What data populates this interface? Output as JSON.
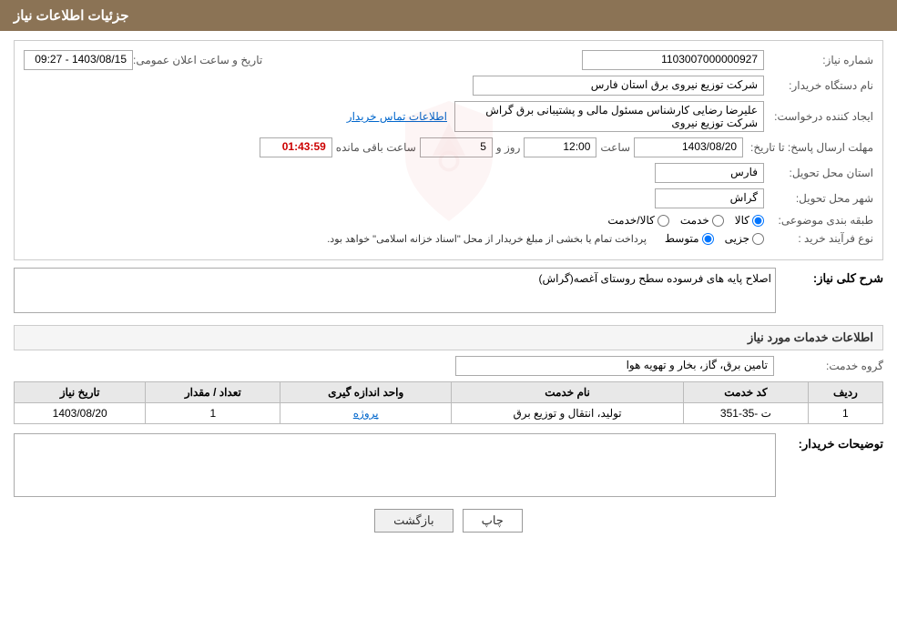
{
  "header": {
    "title": "جزئیات اطلاعات نیاز"
  },
  "fields": {
    "need_number_label": "شماره نیاز:",
    "need_number_value": "1103007000000927",
    "announcement_label": "تاریخ و ساعت اعلان عمومی:",
    "announcement_value": "1403/08/15 - 09:27",
    "buyer_org_label": "نام دستگاه خریدار:",
    "buyer_org_value": "شرکت توزیع نیروی برق استان فارس",
    "creator_label": "ایجاد کننده درخواست:",
    "creator_value": "علیرضا رضایی کارشناس مسئول مالی و پشتیبانی برق گراش شرکت توزیع نیروی",
    "contact_link": "اطلاعات تماس خریدار",
    "deadline_label": "مهلت ارسال پاسخ: تا تاریخ:",
    "deadline_date": "1403/08/20",
    "deadline_time_label": "ساعت",
    "deadline_time": "12:00",
    "deadline_day_label": "روز و",
    "deadline_days": "5",
    "deadline_remain_label": "ساعت باقی مانده",
    "deadline_remain": "01:43:59",
    "province_label": "استان محل تحویل:",
    "province_value": "فارس",
    "city_label": "شهر محل تحویل:",
    "city_value": "گراش",
    "category_label": "طبقه بندی موضوعی:",
    "category_radio_options": [
      "کالا",
      "خدمت",
      "کالا/خدمت"
    ],
    "category_selected": "کالا",
    "purchase_type_label": "نوع فرآیند خرید :",
    "purchase_radio_options": [
      "جزیی",
      "متوسط"
    ],
    "purchase_note": "پرداخت تمام یا بخشی از مبلغ خریدار از محل \"اسناد خزانه اسلامی\" خواهد بود.",
    "need_summary_label": "شرح کلی نیاز:",
    "need_summary_value": "اصلاح پایه های فرسوده سطح روستای آغصه(گراش)",
    "services_title": "اطلاعات خدمات مورد نیاز",
    "service_group_label": "گروه خدمت:",
    "service_group_value": "تامین برق، گاز، بخار و تهویه هوا",
    "table": {
      "headers": [
        "ردیف",
        "کد خدمت",
        "نام خدمت",
        "واحد اندازه گیری",
        "تعداد / مقدار",
        "تاریخ نیاز"
      ],
      "rows": [
        {
          "row": "1",
          "code": "ت -35-351",
          "name": "تولید، انتقال و توزیع برق",
          "unit": "پروژه",
          "quantity": "1",
          "date": "1403/08/20"
        }
      ]
    },
    "buyer_notes_label": "توضیحات خریدار:",
    "buyer_notes_value": "",
    "btn_print": "چاپ",
    "btn_back": "بازگشت"
  }
}
